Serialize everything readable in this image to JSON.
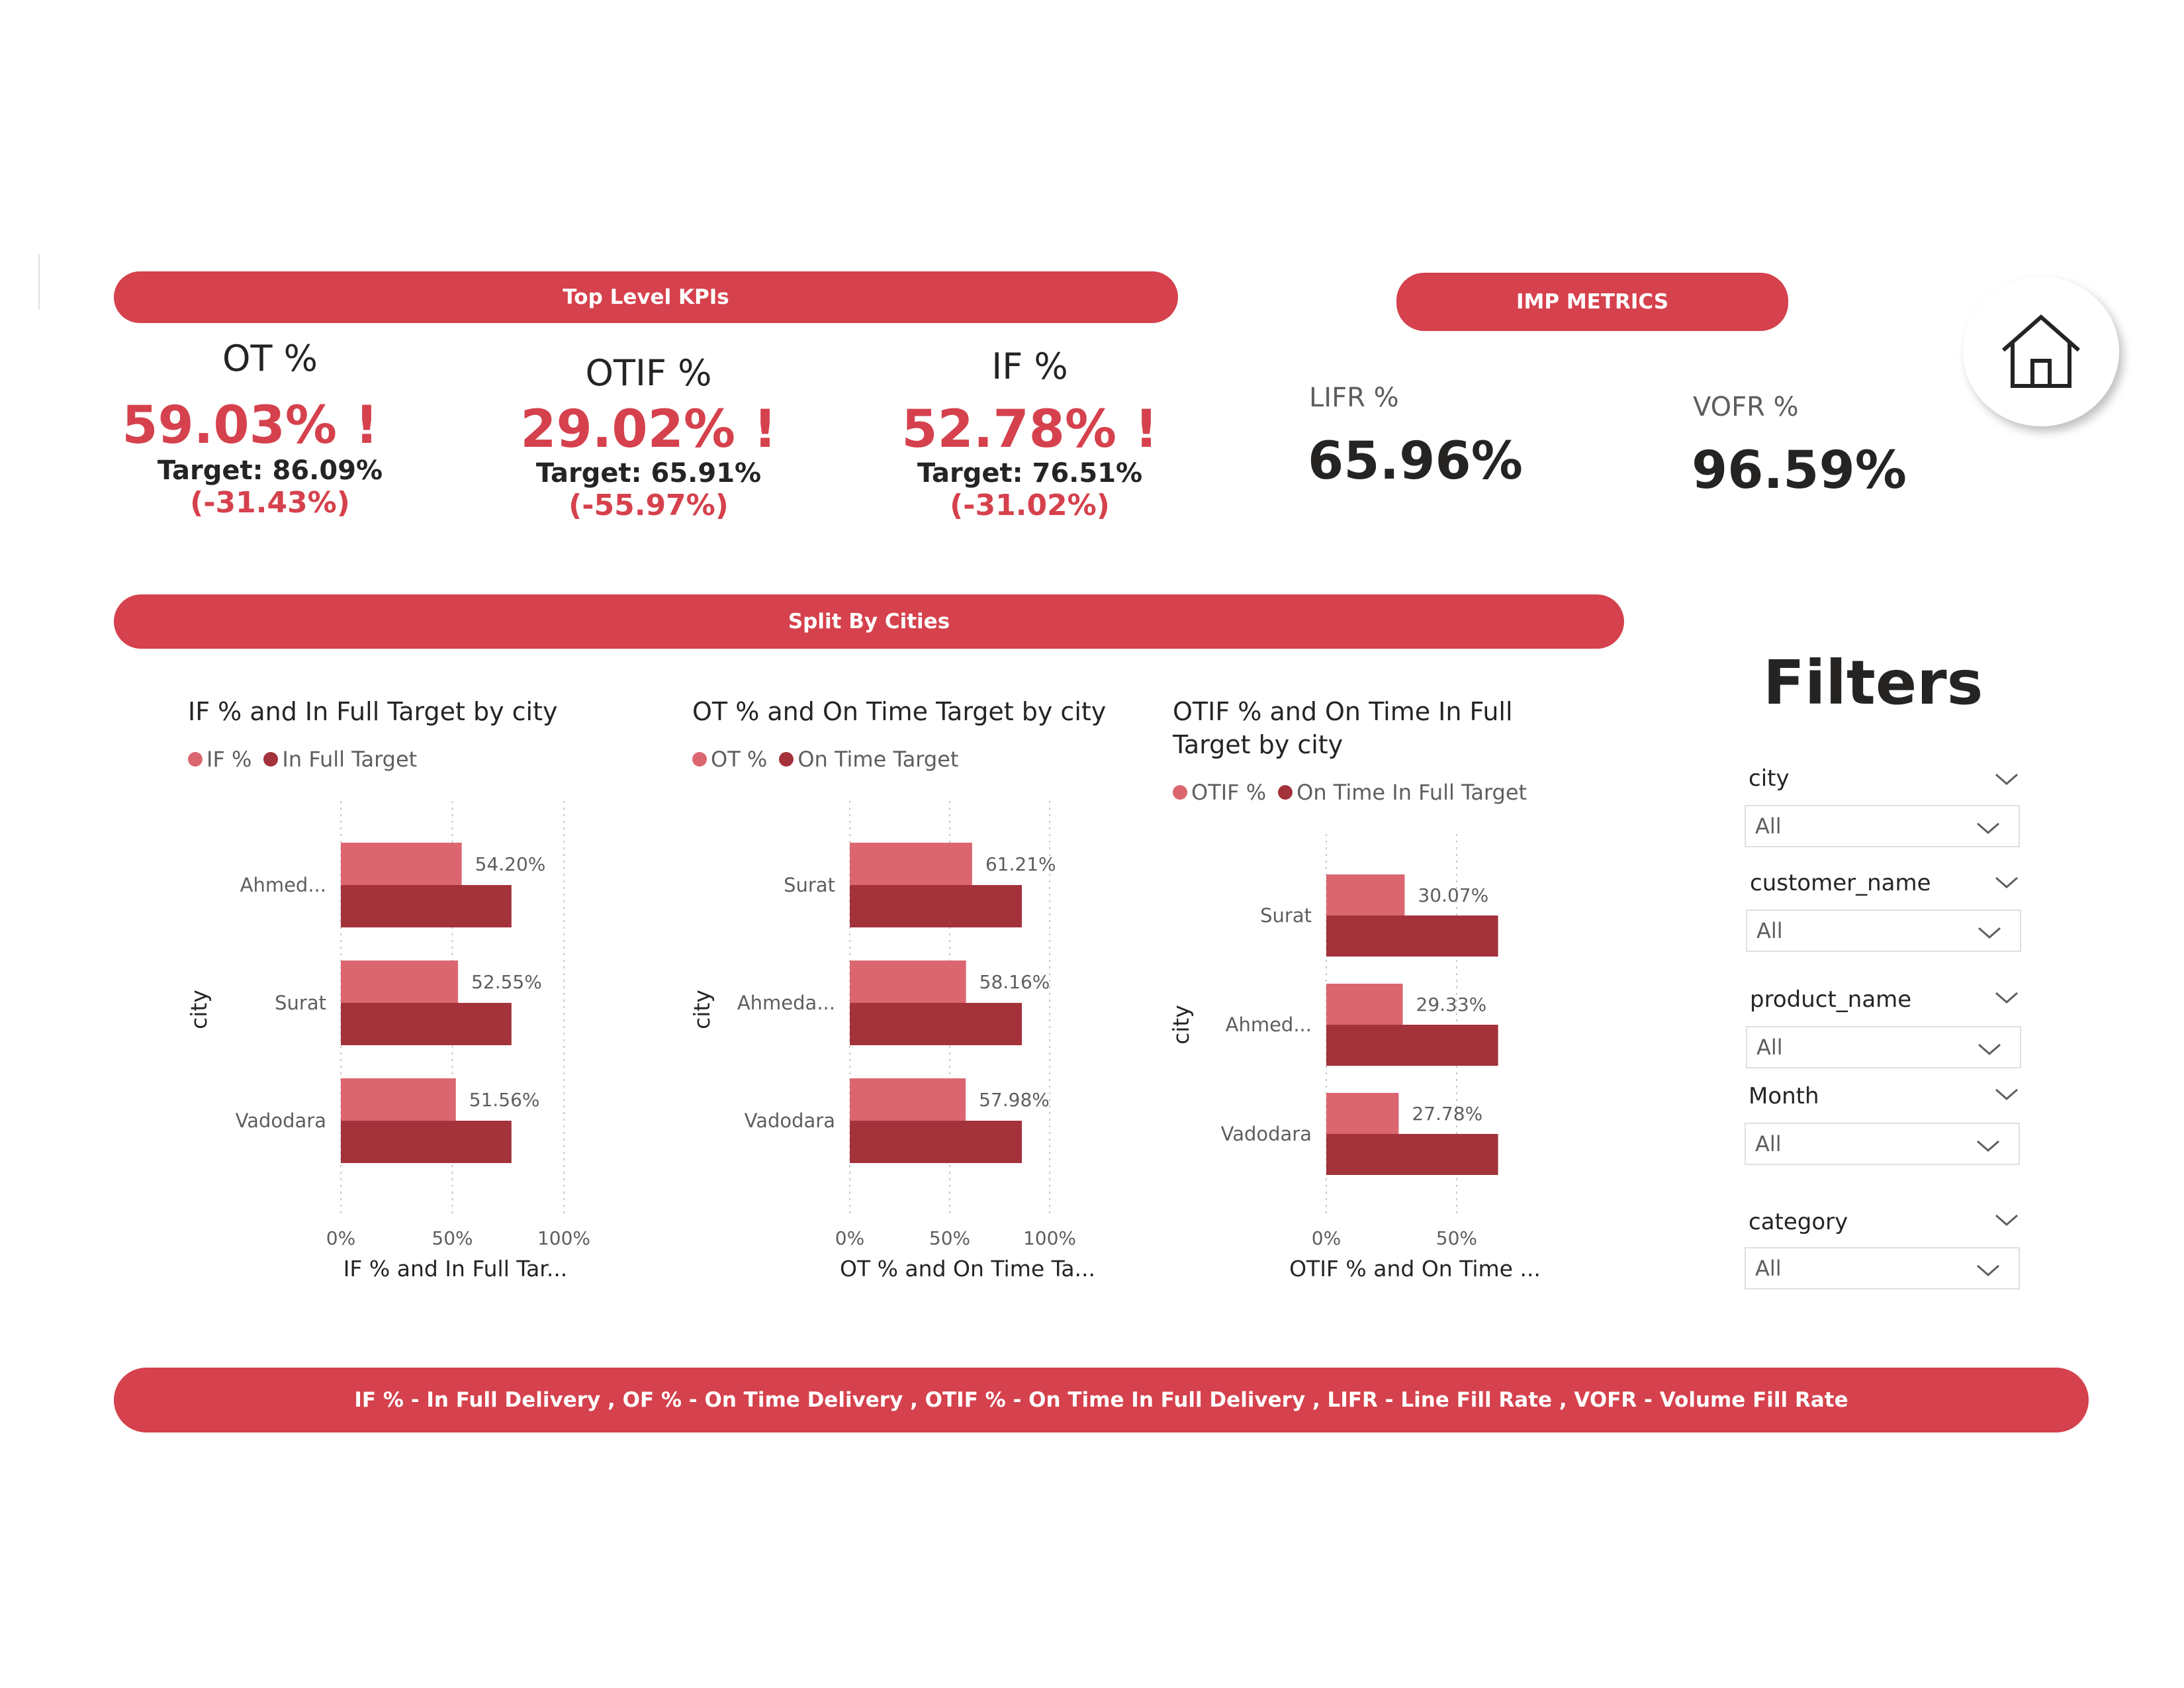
{
  "colors": {
    "accent": "#d5414c",
    "series_light": "#dc6670",
    "series_dark": "#a3323b"
  },
  "header": {
    "kpi_pill": "Top Level KPIs",
    "metrics_pill": "IMP METRICS",
    "split_pill": "Split By Cities"
  },
  "kpis": [
    {
      "label": "OT %",
      "value": "59.03% !",
      "target": "Target: 86.09%",
      "diff": "(-31.43%)"
    },
    {
      "label": "OTIF %",
      "value": "29.02% !",
      "target": "Target: 65.91%",
      "diff": "(-55.97%)"
    },
    {
      "label": "IF %",
      "value": "52.78% !",
      "target": "Target: 76.51%",
      "diff": "(-31.02%)"
    }
  ],
  "metrics": [
    {
      "label": "LIFR %",
      "value": "65.96%"
    },
    {
      "label": "VOFR %",
      "value": "96.59%"
    }
  ],
  "home": {
    "icon": "home-icon"
  },
  "chart_data": [
    {
      "type": "bar",
      "orientation": "horizontal",
      "title": "IF % and In Full Target by city",
      "xlabel": "IF % and In Full Tar...",
      "ylabel": "city",
      "categories": [
        "Ahmed...",
        "Surat",
        "Vadodara"
      ],
      "series": [
        {
          "name": "IF %",
          "values": [
            54.2,
            52.55,
            51.56
          ],
          "data_labels": [
            "54.20%",
            "52.55%",
            "51.56%"
          ]
        },
        {
          "name": "In Full Target",
          "values": [
            76.51,
            76.51,
            76.51
          ]
        }
      ],
      "xlim": [
        0,
        100
      ],
      "x_ticks": [
        "0%",
        "50%",
        "100%"
      ],
      "grid": true,
      "legend": "top-left"
    },
    {
      "type": "bar",
      "orientation": "horizontal",
      "title": "OT % and On Time Target by city",
      "xlabel": "OT % and On Time Ta...",
      "ylabel": "city",
      "categories": [
        "Surat",
        "Ahmeda...",
        "Vadodara"
      ],
      "series": [
        {
          "name": "OT %",
          "values": [
            61.21,
            58.16,
            57.98
          ],
          "data_labels": [
            "61.21%",
            "58.16%",
            "57.98%"
          ]
        },
        {
          "name": "On Time Target",
          "values": [
            86.09,
            86.09,
            86.09
          ]
        }
      ],
      "xlim": [
        0,
        100
      ],
      "x_ticks": [
        "0%",
        "50%",
        "100%"
      ],
      "grid": true,
      "legend": "top-left"
    },
    {
      "type": "bar",
      "orientation": "horizontal",
      "title": "OTIF % and On Time In Full Target by city",
      "title_lines": [
        "OTIF % and On Time In Full",
        "Target by city"
      ],
      "xlabel": "OTIF % and On Time ...",
      "ylabel": "city",
      "categories": [
        "Surat",
        "Ahmed...",
        "Vadodara"
      ],
      "series": [
        {
          "name": "OTIF %",
          "values": [
            30.07,
            29.33,
            27.78
          ],
          "data_labels": [
            "30.07%",
            "29.33%",
            "27.78%"
          ]
        },
        {
          "name": "On Time In Full Target",
          "values": [
            65.91,
            65.91,
            65.91
          ]
        }
      ],
      "xlim": [
        0,
        65
      ],
      "x_ticks": [
        "0%",
        "50%"
      ],
      "grid": true,
      "legend": "top-left"
    }
  ],
  "filters": {
    "title": "Filters",
    "slicers": [
      {
        "label": "city",
        "value": "All"
      },
      {
        "label": "customer_name",
        "value": "All"
      },
      {
        "label": "product_name",
        "value": "All"
      },
      {
        "label": "Month",
        "value": "All"
      },
      {
        "label": "category",
        "value": "All"
      }
    ]
  },
  "footer": {
    "text": "IF % - In Full Delivery , OF % - On Time Delivery , OTIF % - On Time In Full Delivery , LIFR - Line Fill Rate , VOFR - Volume Fill Rate"
  }
}
